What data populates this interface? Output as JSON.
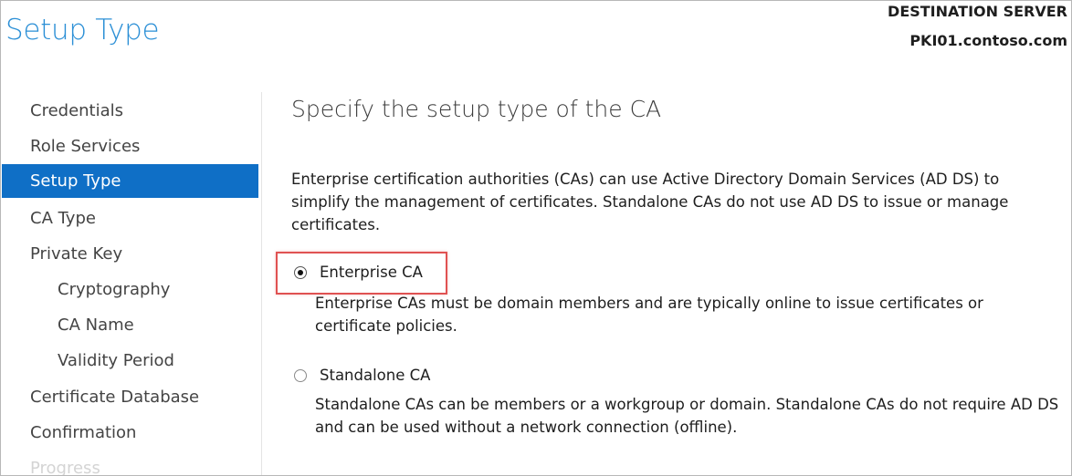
{
  "header": {
    "title": "Setup Type",
    "destination_label": "DESTINATION SERVER",
    "destination_server": "PKI01.contoso.com"
  },
  "sidebar": {
    "items": [
      {
        "label": "Credentials",
        "state": "normal"
      },
      {
        "label": "Role Services",
        "state": "normal"
      },
      {
        "label": "Setup Type",
        "state": "selected"
      },
      {
        "label": "CA Type",
        "state": "normal"
      },
      {
        "label": "Private Key",
        "state": "normal"
      },
      {
        "label": "Cryptography",
        "state": "normal",
        "indent": true
      },
      {
        "label": "CA Name",
        "state": "normal",
        "indent": true
      },
      {
        "label": "Validity Period",
        "state": "normal",
        "indent": true
      },
      {
        "label": "Certificate Database",
        "state": "normal"
      },
      {
        "label": "Confirmation",
        "state": "normal"
      },
      {
        "label": "Progress",
        "state": "disabled"
      }
    ]
  },
  "main": {
    "section_title": "Specify the setup type of the CA",
    "description": "Enterprise certification authorities (CAs) can use Active Directory Domain Services (AD DS) to simplify the management of certificates. Standalone CAs do not use AD DS to issue or manage certificates.",
    "options": [
      {
        "label": "Enterprise CA",
        "selected": true,
        "description": "Enterprise CAs must be domain members and are typically online to issue certificates or certificate policies."
      },
      {
        "label": "Standalone CA",
        "selected": false,
        "description": "Standalone CAs can be members or a workgroup or domain. Standalone CAs do not require AD DS and can be used without a network connection (offline)."
      }
    ]
  },
  "colors": {
    "title_blue": "#2b8fd6",
    "selected_nav_bg": "#0f6fc6",
    "highlight_red": "#e05252"
  }
}
